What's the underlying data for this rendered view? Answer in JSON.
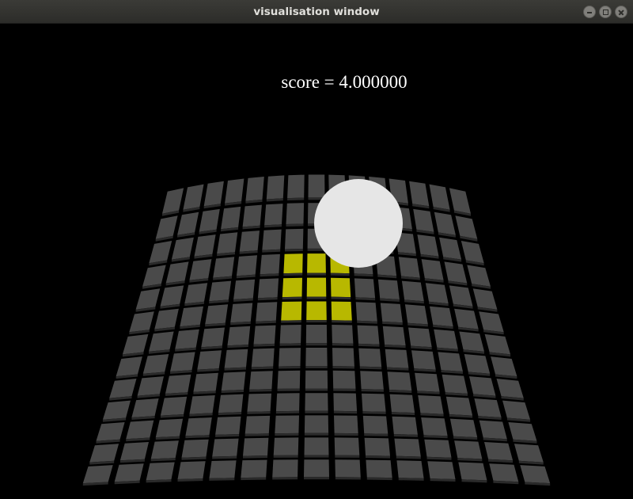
{
  "window": {
    "title": "visualisation window"
  },
  "hud": {
    "score_text": "score = 4.000000"
  },
  "scene": {
    "grid_rows": 13,
    "grid_cols": 15,
    "tile_color": "#4a4a4a",
    "highlight_color": "#b8b800",
    "ball_color": "#e6e6e6",
    "highlighted_tiles": [
      [
        3,
        6
      ],
      [
        3,
        7
      ],
      [
        3,
        8
      ],
      [
        4,
        6
      ],
      [
        4,
        7
      ],
      [
        4,
        8
      ],
      [
        5,
        6
      ],
      [
        5,
        7
      ],
      [
        5,
        8
      ]
    ]
  }
}
